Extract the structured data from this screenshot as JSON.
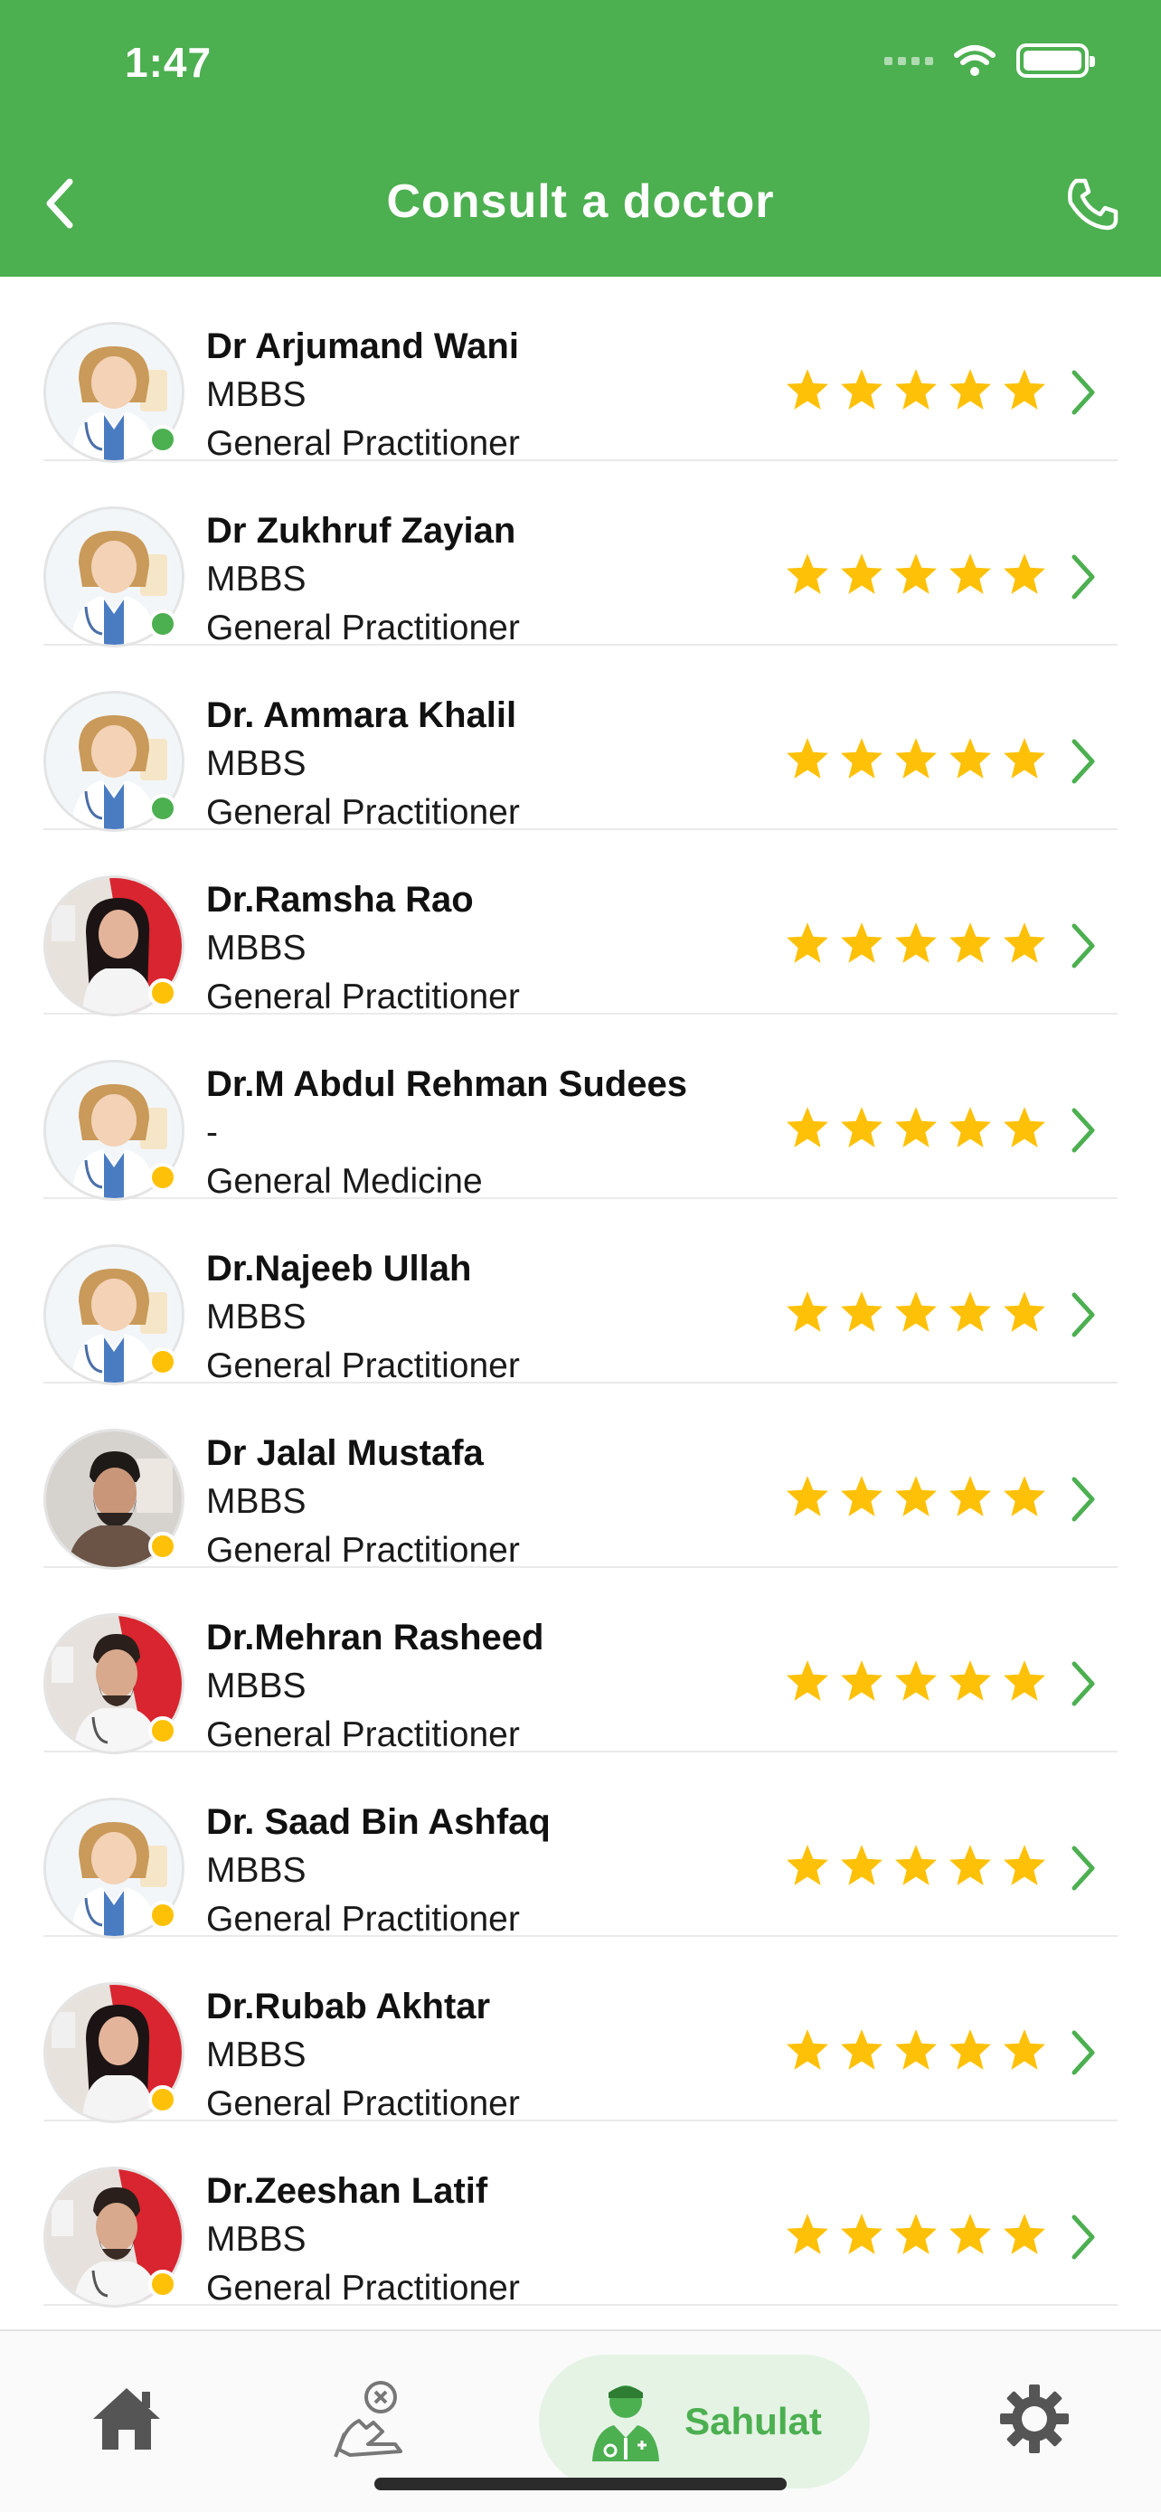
{
  "status_bar": {
    "time": "1:47"
  },
  "header": {
    "title": "Consult a doctor"
  },
  "colors": {
    "brand_green": "#4CAF50",
    "star": "#FFC107",
    "online": "#4CAF50",
    "away": "#FFC107"
  },
  "doctors": [
    {
      "name": "Dr Arjumand Wani",
      "degree": "MBBS",
      "specialty": "General Practitioner",
      "status": "online",
      "avatar": "default-female",
      "rating": 5
    },
    {
      "name": "Dr Zukhruf Zayian",
      "degree": "MBBS",
      "specialty": "General Practitioner",
      "status": "online",
      "avatar": "default-female",
      "rating": 5
    },
    {
      "name": "Dr. Ammara Khalil",
      "degree": "MBBS",
      "specialty": "General Practitioner",
      "status": "online",
      "avatar": "default-female",
      "rating": 5
    },
    {
      "name": "Dr.Ramsha Rao",
      "degree": "MBBS",
      "specialty": "General Practitioner",
      "status": "away",
      "avatar": "photo-female",
      "rating": 5
    },
    {
      "name": "Dr.M Abdul Rehman Sudees",
      "degree": "-",
      "specialty": "General Medicine",
      "status": "away",
      "avatar": "default-female",
      "rating": 5
    },
    {
      "name": "Dr.Najeeb Ullah",
      "degree": "MBBS",
      "specialty": "General Practitioner",
      "status": "away",
      "avatar": "default-female",
      "rating": 5
    },
    {
      "name": "Dr Jalal Mustafa",
      "degree": "MBBS",
      "specialty": "General Practitioner",
      "status": "away",
      "avatar": "photo-male-beard",
      "rating": 5
    },
    {
      "name": "Dr.Mehran Rasheed",
      "degree": "MBBS",
      "specialty": "General Practitioner",
      "status": "away",
      "avatar": "photo-male",
      "rating": 5
    },
    {
      "name": "Dr. Saad Bin Ashfaq",
      "degree": "MBBS",
      "specialty": "General Practitioner",
      "status": "away",
      "avatar": "default-female",
      "rating": 5
    },
    {
      "name": "Dr.Rubab Akhtar",
      "degree": "MBBS",
      "specialty": "General Practitioner",
      "status": "away",
      "avatar": "photo-female",
      "rating": 5
    },
    {
      "name": "Dr.Zeeshan Latif",
      "degree": "MBBS",
      "specialty": "General Practitioner",
      "status": "away",
      "avatar": "photo-male",
      "rating": 5
    }
  ],
  "tabbar": {
    "items": [
      {
        "icon": "home-icon"
      },
      {
        "icon": "care-icon"
      },
      {
        "icon": "doctor-icon",
        "label": "Sahulat",
        "active": true
      },
      {
        "icon": "gear-icon"
      }
    ]
  }
}
